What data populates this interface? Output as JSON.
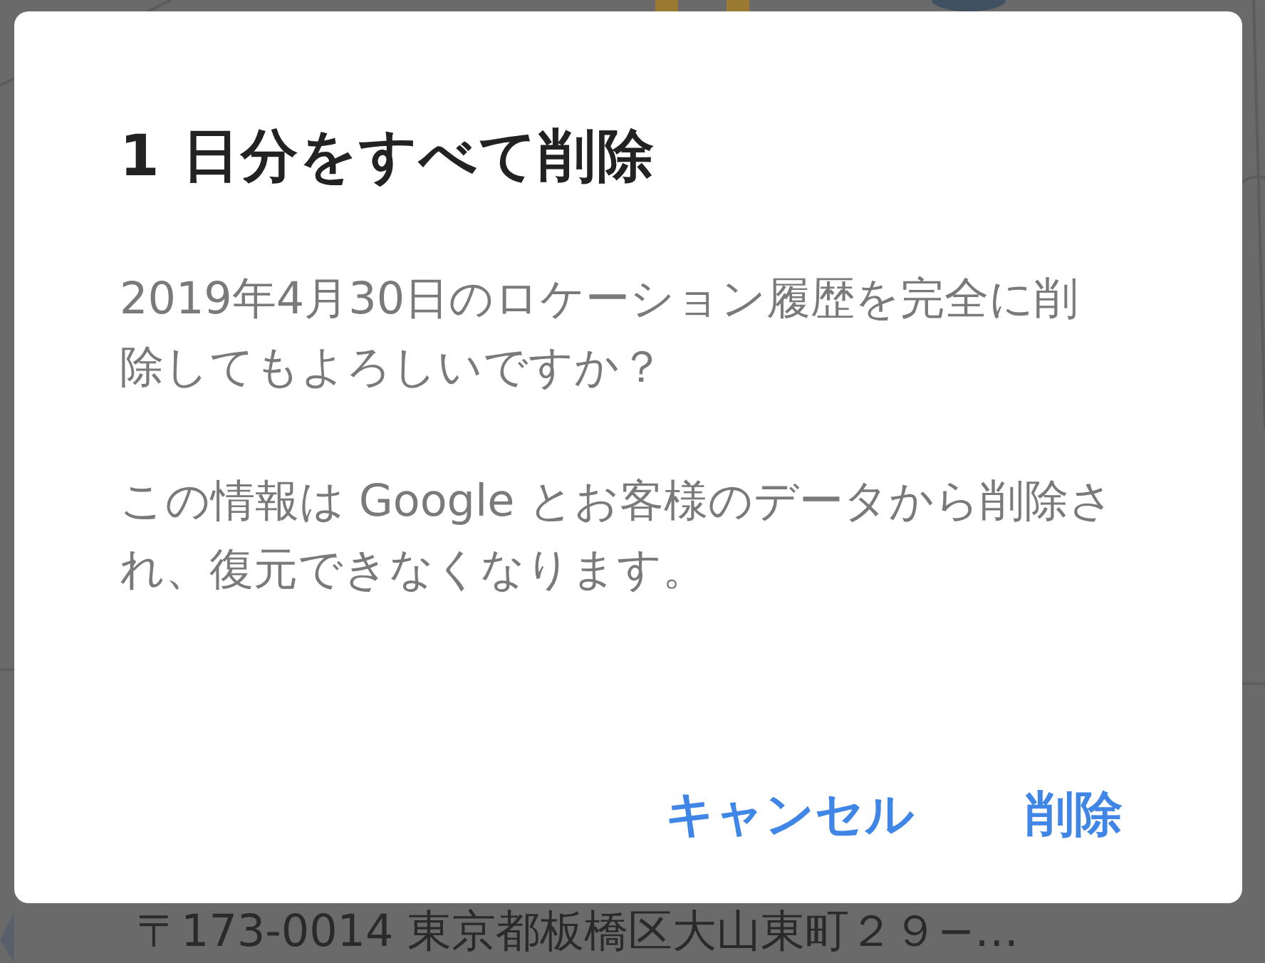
{
  "dialog": {
    "title": "1 日分をすべて削除",
    "paragraphs": [
      "2019年4月30日のロケーション履歴を完全に削除してもよろしいですか？",
      "この情報は Google とお客様のデータから削除され、復元できなくなります。"
    ],
    "buttons": [
      {
        "label": "キャンセル"
      },
      {
        "label": "削除"
      }
    ]
  },
  "background": {
    "address": "〒173-0014 東京都板橋区大山東町２９−…"
  }
}
